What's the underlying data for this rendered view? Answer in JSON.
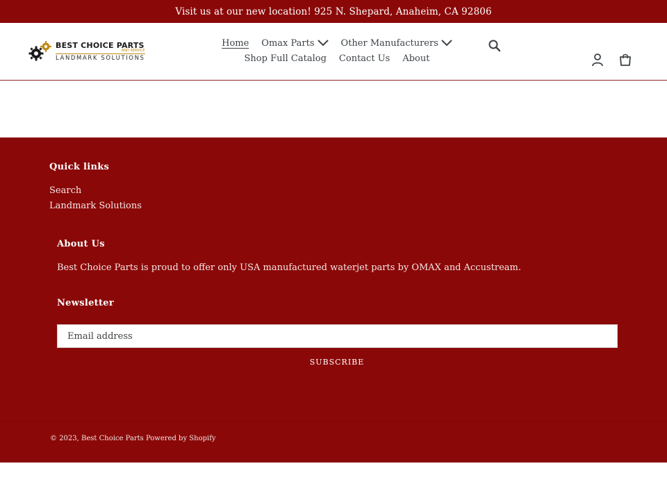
{
  "announcement": {
    "text": "Visit us at our new location! 925 N. Shepard, Anaheim, CA 92806"
  },
  "logo": {
    "main": "BEST CHOICE PARTS",
    "sub": "AND SERVICE",
    "landmark": "LANDMARK SOLUTIONS"
  },
  "nav": {
    "items": [
      {
        "label": "Home",
        "active": true
      },
      {
        "label": "Omax Parts",
        "dropdown": true
      },
      {
        "label": "Other Manufacturers",
        "dropdown": true
      },
      {
        "label": "Shop Full Catalog"
      },
      {
        "label": "Contact Us"
      },
      {
        "label": "About"
      }
    ]
  },
  "header_icons": [
    "search-icon",
    "account-icon",
    "cart-icon"
  ],
  "footer": {
    "quick_links": {
      "heading": "Quick links",
      "links": [
        "Search",
        "Landmark Solutions"
      ]
    },
    "about": {
      "heading": "About Us",
      "text": "Best Choice Parts is proud to offer only USA manufactured waterjet parts by OMAX and Accustream."
    },
    "newsletter": {
      "heading": "Newsletter",
      "placeholder": "Email address",
      "button": "SUBSCRIBE"
    },
    "copyright": {
      "year_text": "© 2023, ",
      "store": "Best Choice Parts",
      "powered": " Powered by Shopify"
    }
  },
  "colors": {
    "brand": "#8b0808",
    "text": "#3d4246",
    "logo_gold": "#c08a16"
  }
}
